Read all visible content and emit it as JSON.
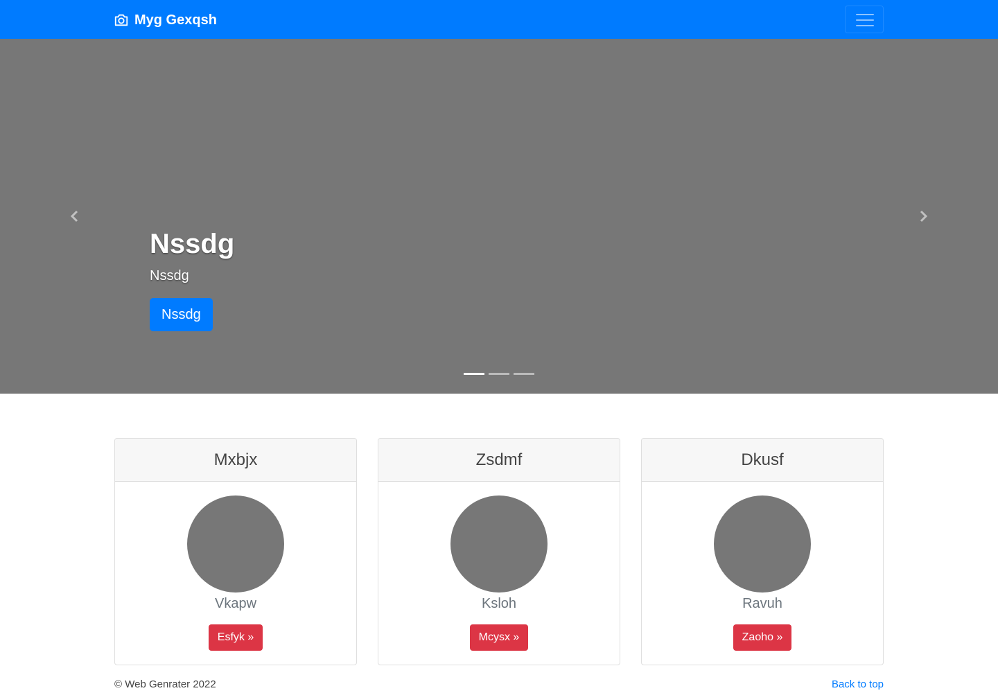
{
  "navbar": {
    "brand": "Myg Gexqsh",
    "brand_icon": "camera-icon",
    "toggler_icon": "hamburger-menu-icon",
    "color": "#007bff"
  },
  "carousel": {
    "heading": "Nssdg",
    "text": "Nssdg",
    "button_label": "Nssdg",
    "prev_icon": "chevron-left-icon",
    "next_icon": "chevron-right-icon",
    "active_slide": 1,
    "slide_count": 3,
    "background": "#777777"
  },
  "cards": [
    {
      "title": "Mxbjx",
      "name": "Vkapw",
      "button_label": "Esfyk »"
    },
    {
      "title": "Zsdmf",
      "name": "Ksloh",
      "button_label": "Mcysx »"
    },
    {
      "title": "Dkusf",
      "name": "Ravuh",
      "button_label": "Zaoho »"
    }
  ],
  "footer": {
    "copyright": "© Web Genrater 2022",
    "back_to_top": "Back to top"
  }
}
